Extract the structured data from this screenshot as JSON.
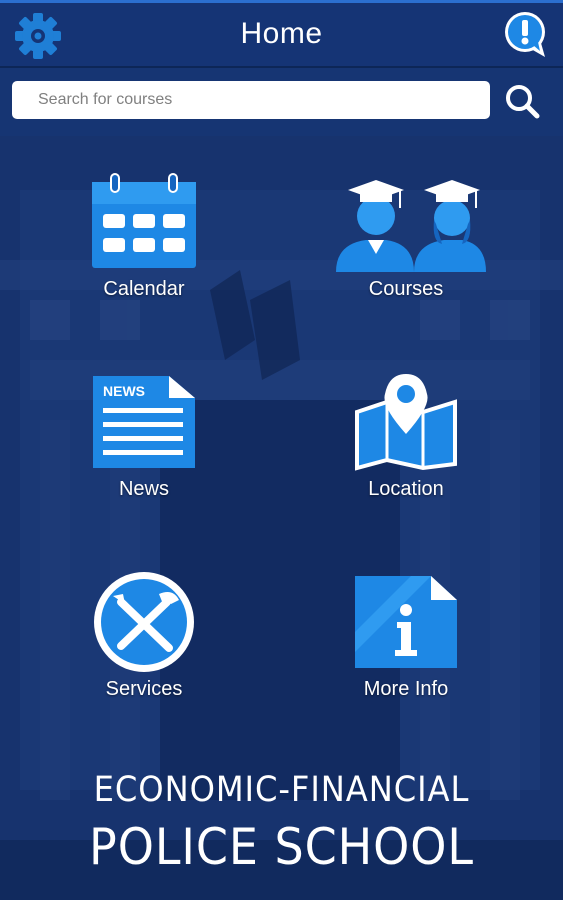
{
  "header": {
    "title": "Home",
    "settings_icon": "gear-icon",
    "help_icon": "help-chat-icon"
  },
  "search": {
    "placeholder": "Search for courses",
    "value": "",
    "button_icon": "search-icon"
  },
  "menu": [
    {
      "label": "Calendar",
      "icon": "calendar-icon"
    },
    {
      "label": "Courses",
      "icon": "graduates-icon"
    },
    {
      "label": "News",
      "icon": "news-icon"
    },
    {
      "label": "Location",
      "icon": "map-pin-icon"
    },
    {
      "label": "Services",
      "icon": "tools-icon"
    },
    {
      "label": "More Info",
      "icon": "info-document-icon"
    }
  ],
  "footer": {
    "line1": "ECONOMIC-FINANCIAL",
    "line2": "POLICE SCHOOL"
  },
  "colors": {
    "background": "#14306b",
    "header": "#153475",
    "icon_blue": "#1e88e5",
    "icon_light": "#2f9bf0",
    "text": "#ffffff"
  }
}
